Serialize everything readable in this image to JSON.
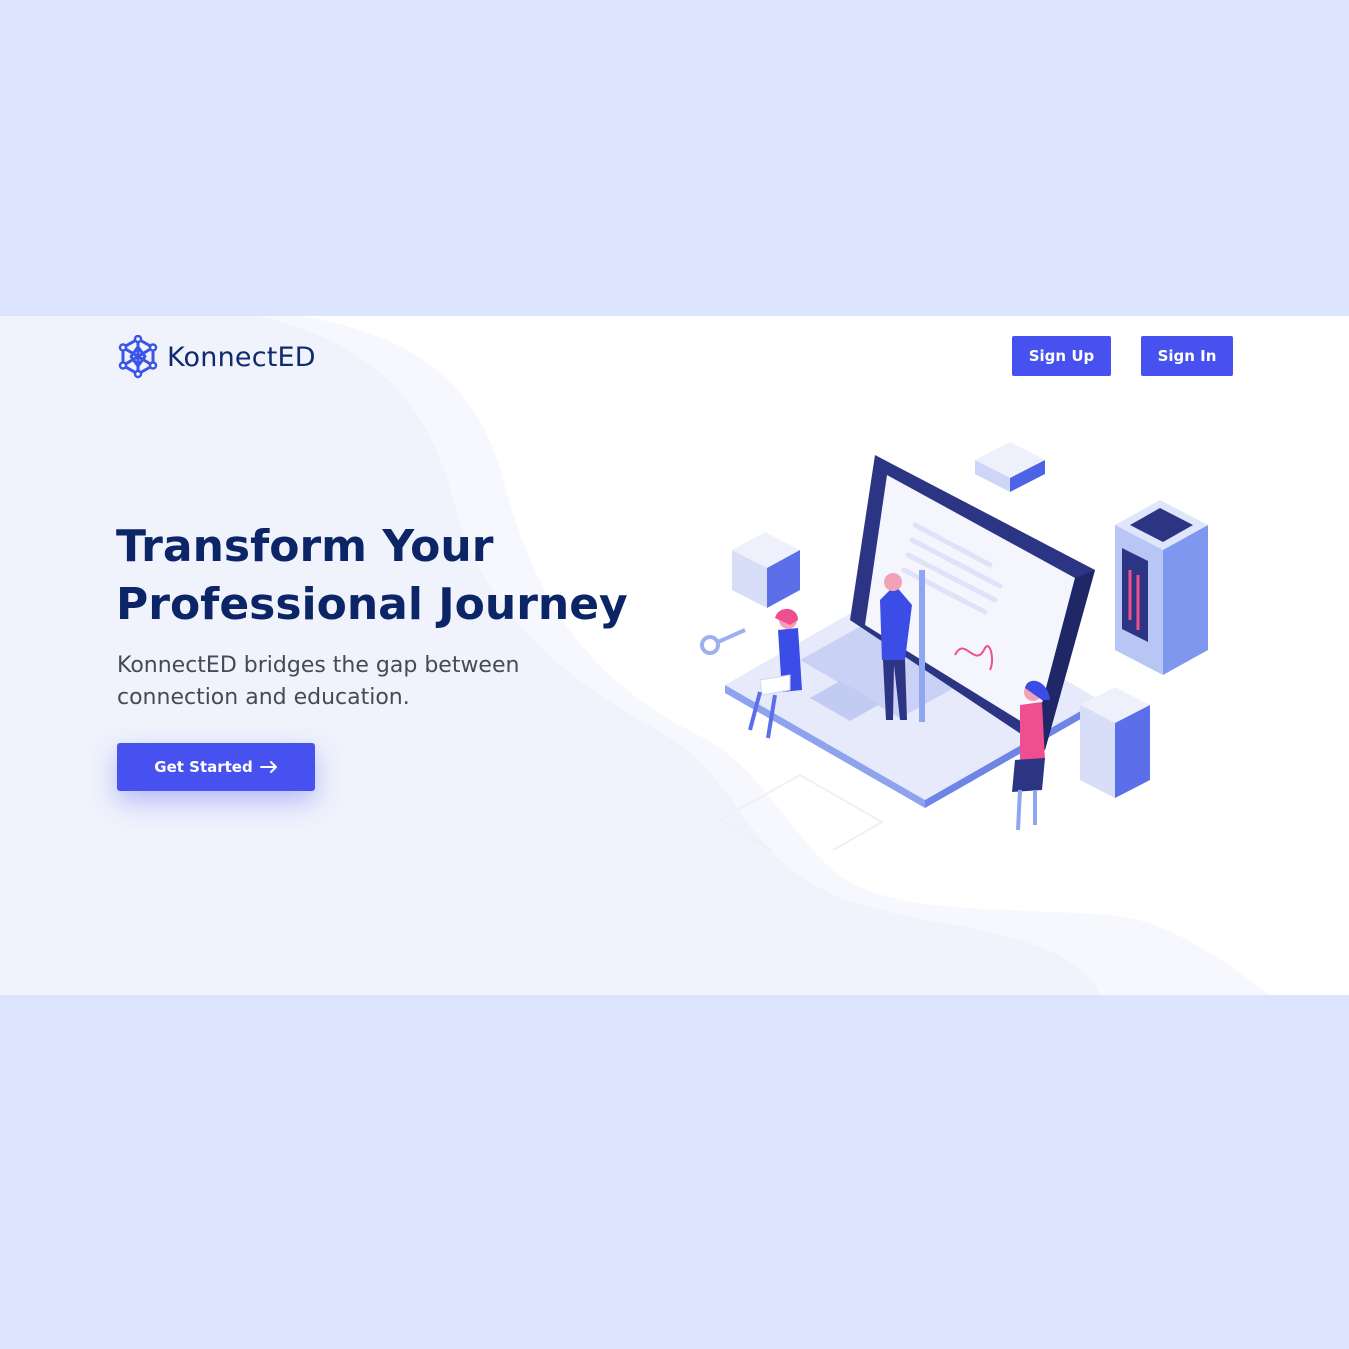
{
  "header": {
    "brand": "KonnectED",
    "logo_icon": "network-hex-icon",
    "signup_label": "Sign Up",
    "signin_label": "Sign In"
  },
  "hero": {
    "title_line1": "Transform Your",
    "title_line2": "Professional Journey",
    "subtitle": "KonnectED bridges the gap between connection and education.",
    "cta_label": "Get Started",
    "cta_icon": "arrow-right-icon",
    "illustration": "isometric-laptop-document-signing-illustration"
  },
  "colors": {
    "accent": "#4651ef",
    "heading": "#0c2566",
    "backdrop": "#dce5fd",
    "wave": "#f2f5fd"
  }
}
